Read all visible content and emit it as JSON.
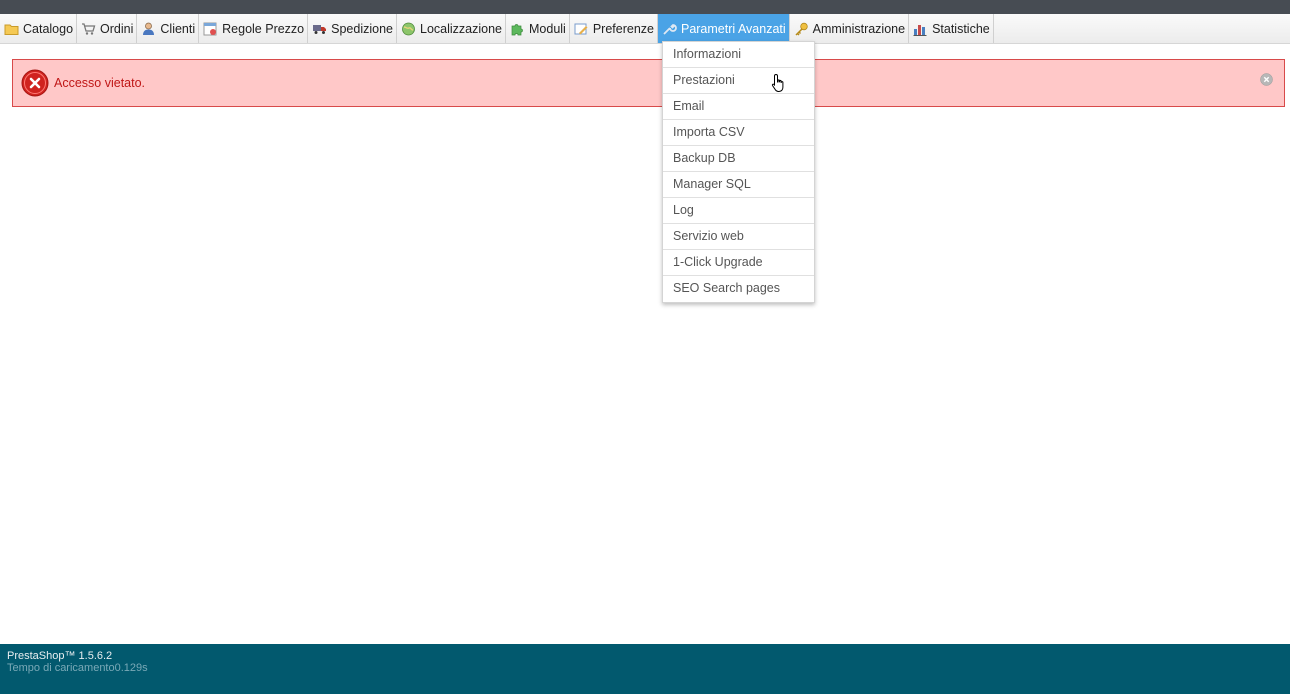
{
  "menu": {
    "items": [
      {
        "label": "Catalogo",
        "icon": "folder-icon"
      },
      {
        "label": "Ordini",
        "icon": "cart-icon"
      },
      {
        "label": "Clienti",
        "icon": "user-icon"
      },
      {
        "label": "Regole Prezzo",
        "icon": "price-rules-icon"
      },
      {
        "label": "Spedizione",
        "icon": "truck-icon"
      },
      {
        "label": "Localizzazione",
        "icon": "globe-icon"
      },
      {
        "label": "Moduli",
        "icon": "puzzle-icon"
      },
      {
        "label": "Preferenze",
        "icon": "preferences-icon"
      },
      {
        "label": "Parametri Avanzati",
        "icon": "wrench-icon",
        "active": true
      },
      {
        "label": "Amministrazione",
        "icon": "key-icon"
      },
      {
        "label": "Statistiche",
        "icon": "bar-chart-icon"
      }
    ]
  },
  "alert": {
    "message": "Accesso vietato."
  },
  "dropdown": {
    "items": [
      "Informazioni",
      "Prestazioni",
      "Email",
      "Importa CSV",
      "Backup DB",
      "Manager SQL",
      "Log",
      "Servizio web",
      "1-Click Upgrade",
      "SEO Search pages"
    ]
  },
  "footer": {
    "version": "PrestaShop™ 1.5.6.2",
    "load_time": "Tempo di caricamento0.129s"
  },
  "colors": {
    "active_tab": "#4aa3e6",
    "alert_bg": "#ffc8c8",
    "alert_border": "#d84a4a",
    "alert_text": "#c01717",
    "footer_bg": "#02596e",
    "topbar": "#474c53"
  }
}
